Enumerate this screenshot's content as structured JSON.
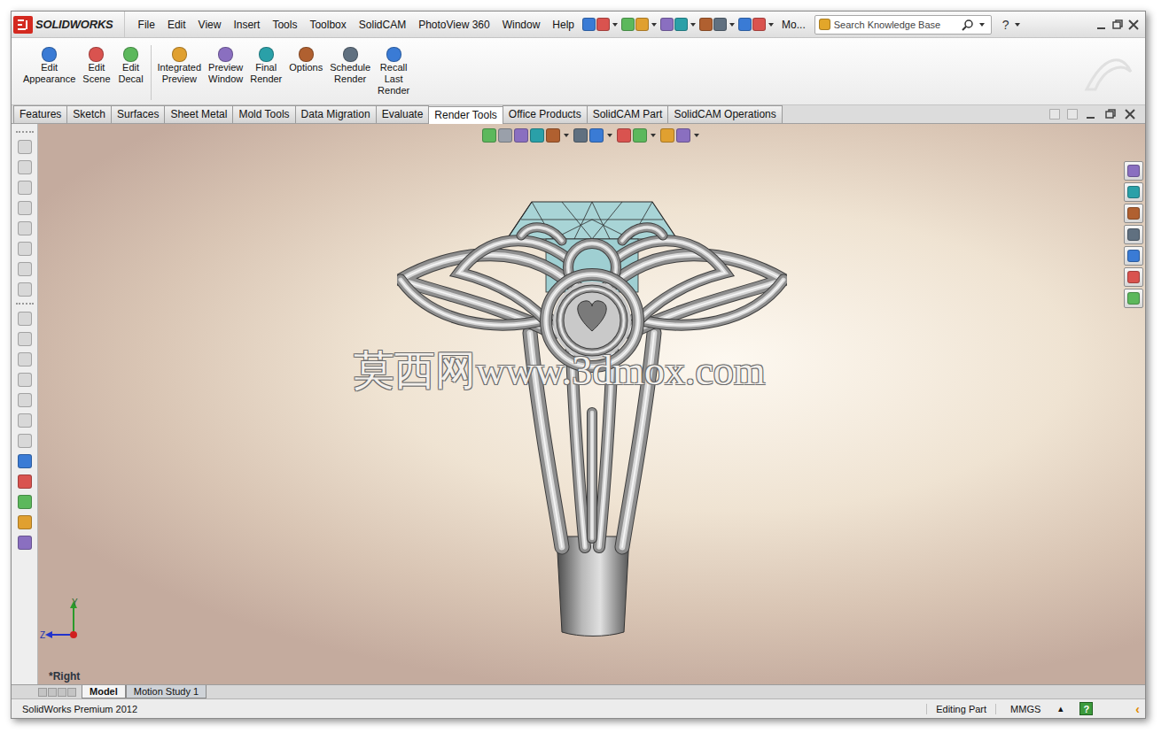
{
  "window": {
    "logo": "SOLIDWORKS"
  },
  "menu": [
    "File",
    "Edit",
    "View",
    "Insert",
    "Tools",
    "Toolbox",
    "SolidCAM",
    "PhotoView 360",
    "Window",
    "Help"
  ],
  "toolbar_overflow": "Mo...",
  "search": {
    "placeholder": "Search Knowledge Base"
  },
  "help": "?",
  "command_groups": [
    [
      {
        "lines": [
          "Edit",
          "Appearance"
        ]
      },
      {
        "lines": [
          "Edit",
          "Scene"
        ]
      },
      {
        "lines": [
          "Edit",
          "Decal"
        ]
      }
    ],
    [
      {
        "lines": [
          "Integrated",
          "Preview"
        ]
      },
      {
        "lines": [
          "Preview",
          "Window"
        ]
      },
      {
        "lines": [
          "Final",
          "Render"
        ]
      },
      {
        "lines": [
          "Options"
        ]
      },
      {
        "lines": [
          "Schedule",
          "Render"
        ]
      },
      {
        "lines": [
          "Recall",
          "Last",
          "Render"
        ]
      }
    ]
  ],
  "tabs": [
    {
      "label": "Features",
      "selected": false
    },
    {
      "label": "Sketch",
      "selected": false
    },
    {
      "label": "Surfaces",
      "selected": false
    },
    {
      "label": "Sheet Metal",
      "selected": false
    },
    {
      "label": "Mold Tools",
      "selected": false
    },
    {
      "label": "Data Migration",
      "selected": false
    },
    {
      "label": "Evaluate",
      "selected": false
    },
    {
      "label": "Render Tools",
      "selected": true
    },
    {
      "label": "Office Products",
      "selected": false
    },
    {
      "label": "SolidCAM Part",
      "selected": false
    },
    {
      "label": "SolidCAM Operations",
      "selected": false
    }
  ],
  "watermark": "莫西网www.3dmox.com",
  "triad": {
    "y": "Y",
    "z": "Z"
  },
  "view_name": "*Right",
  "bottom_tabs": [
    {
      "label": "Model",
      "selected": true
    },
    {
      "label": "Motion Study 1",
      "selected": false
    }
  ],
  "status_bar": {
    "product": "SolidWorks Premium 2012",
    "mode": "Editing Part",
    "units": "MMGS",
    "units_arrow": "▴",
    "help": "?",
    "collapse": "‹"
  }
}
